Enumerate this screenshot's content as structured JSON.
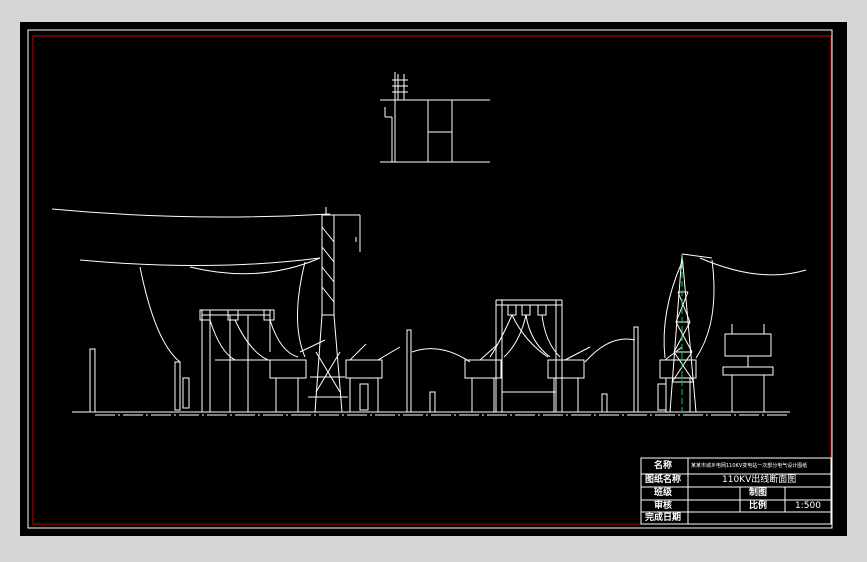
{
  "drawing": {
    "background": "#000000",
    "frame_color": "#cc0000",
    "line_color": "#ffffff",
    "accent_color": "#00cc44"
  },
  "title_block": {
    "row1_label": "名称",
    "row1_value": "某某市城乡电网110KV变电站一次部分电气设计图纸",
    "row2_label": "图纸名称",
    "row2_value": "110KV出线断面图",
    "row3_label": "班级",
    "row3_value": "制图",
    "row4_label": "审核",
    "row4_value": "比例",
    "row4_scale": "1:500",
    "row5_label": "完成日期"
  }
}
